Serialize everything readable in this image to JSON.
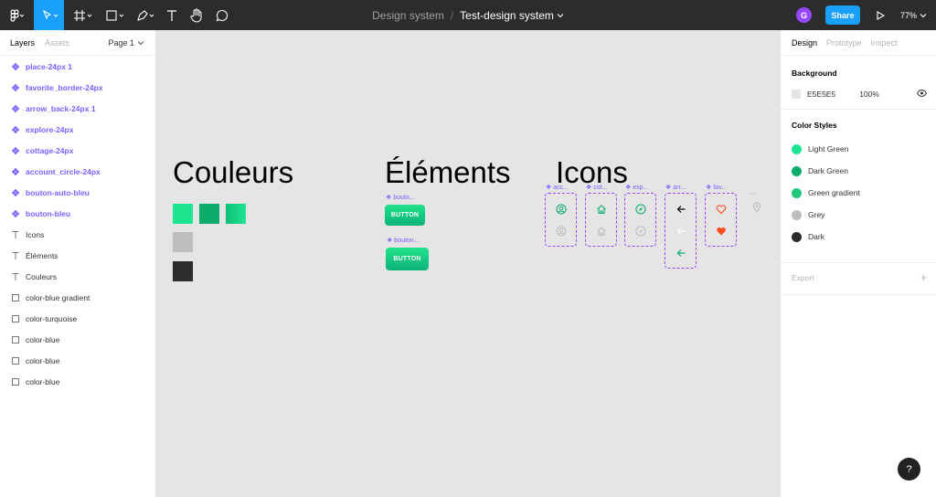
{
  "toolbar": {
    "icons": [
      "figma-menu-icon",
      "move-tool-icon",
      "frame-tool-icon",
      "shape-tool-icon",
      "pen-tool-icon",
      "text-tool-icon",
      "hand-tool-icon",
      "comment-tool-icon"
    ],
    "project": "Design system",
    "separator": "/",
    "file_name": "Test-design system",
    "avatar_initial": "G",
    "share_label": "Share",
    "zoom": "77%",
    "active_color": "#18a0fb"
  },
  "left_panel": {
    "tabs": [
      "Layers",
      "Assets"
    ],
    "page": "Page 1",
    "layers": [
      {
        "name": "place-24px 1",
        "kind": "component"
      },
      {
        "name": "favorite_border-24px",
        "kind": "component"
      },
      {
        "name": "arrow_back-24px 1",
        "kind": "component"
      },
      {
        "name": "explore-24px",
        "kind": "component"
      },
      {
        "name": "cottage-24px",
        "kind": "component"
      },
      {
        "name": "account_circle-24px",
        "kind": "component"
      },
      {
        "name": "bouton-auto-bleu",
        "kind": "component"
      },
      {
        "name": "bouton-bleu",
        "kind": "component"
      },
      {
        "name": "Icons",
        "kind": "text"
      },
      {
        "name": "Éléments",
        "kind": "text"
      },
      {
        "name": "Couleurs",
        "kind": "text"
      },
      {
        "name": "color-blue gradient",
        "kind": "rectangle"
      },
      {
        "name": "color-turquoise",
        "kind": "rectangle"
      },
      {
        "name": "color-blue",
        "kind": "rectangle"
      },
      {
        "name": "color-blue",
        "kind": "rectangle"
      },
      {
        "name": "color-blue",
        "kind": "rectangle"
      }
    ]
  },
  "canvas": {
    "background": "#e5e5e5",
    "titles": {
      "colors": "Couleurs",
      "elements": "Éléments",
      "icons": "Icons"
    },
    "swatches": [
      "#1de58f",
      "#0aad6b",
      "gradient",
      "#bdbdbd",
      "#2c2c2c"
    ],
    "buttons": [
      {
        "label": "bouto...",
        "text": "BUTTON"
      },
      {
        "label": "bouton...",
        "text": "BUTTON"
      }
    ],
    "icon_sets": [
      {
        "label": "acc...",
        "icons": [
          "account-circle-icon",
          "account-circle-icon"
        ]
      },
      {
        "label": "cot...",
        "icons": [
          "cottage-icon",
          "cottage-icon"
        ]
      },
      {
        "label": "exp...",
        "icons": [
          "explore-icon",
          "explore-icon"
        ]
      },
      {
        "label": "arr...",
        "icons": [
          "arrow-back-icon",
          "arrow-back-icon",
          "arrow-back-icon"
        ]
      },
      {
        "label": "fav...",
        "icons": [
          "favorite-border-icon",
          "favorite-icon"
        ]
      },
      {
        "label": "...",
        "icons": [
          "place-icon"
        ]
      }
    ]
  },
  "right_panel": {
    "tabs": [
      "Design",
      "Prototype",
      "Inspect"
    ],
    "background": {
      "heading": "Background",
      "hex": "E5E5E5",
      "opacity": "100%"
    },
    "color_styles": {
      "heading": "Color Styles",
      "items": [
        {
          "name": "Light Green",
          "color": "#1de58f"
        },
        {
          "name": "Dark Green",
          "color": "#0aad6b"
        },
        {
          "name": "Green gradient",
          "color": "#22c97c"
        },
        {
          "name": "Grey",
          "color": "#bdbdbd"
        },
        {
          "name": "Dark",
          "color": "#2c2c2c"
        }
      ]
    },
    "export_label": "Export",
    "export_plus": "+"
  },
  "help_label": "?"
}
